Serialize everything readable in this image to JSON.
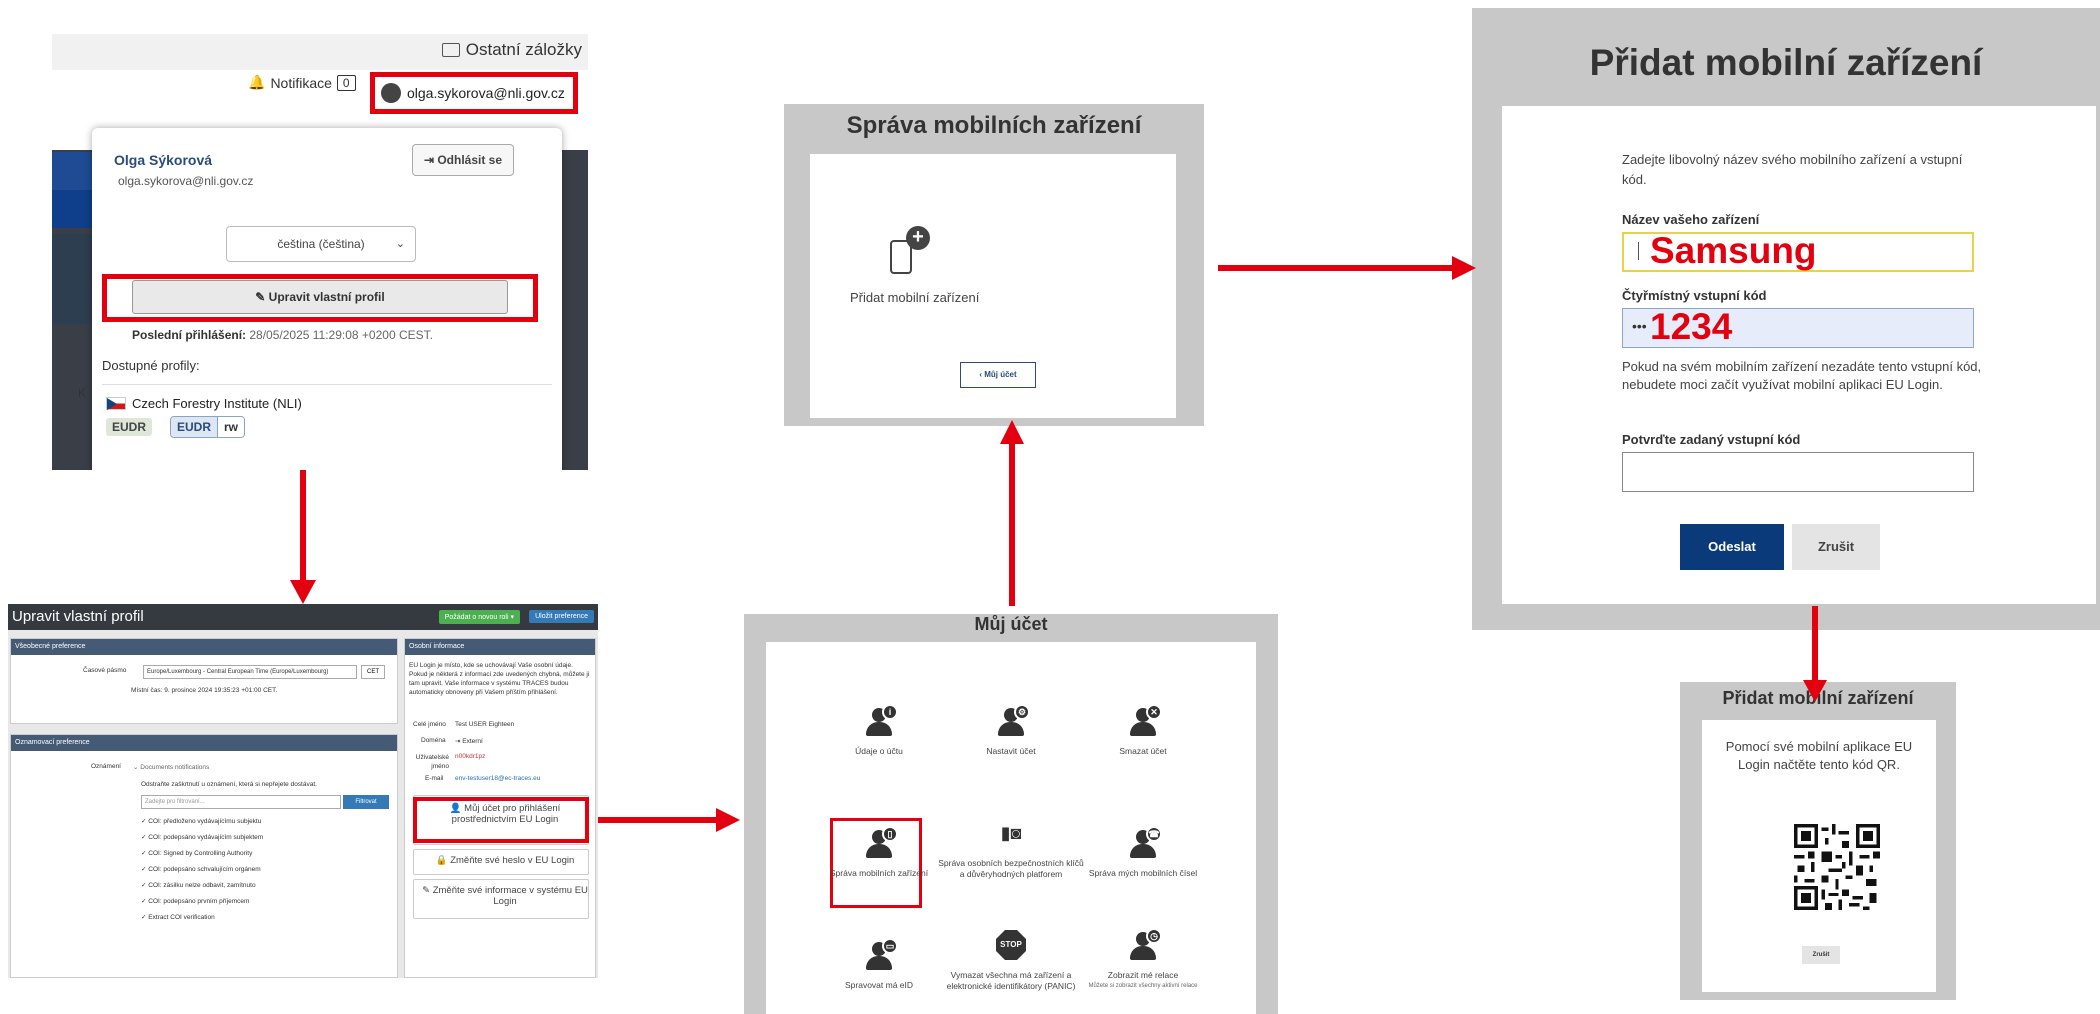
{
  "colors": {
    "highlight": "#e3000f",
    "primary": "#0b3a7a",
    "panel_bg": "#c8c8c8"
  },
  "panel1": {
    "bookmarks": "Ostatní záložky",
    "notifications_label": "Notifikace",
    "notifications_count": "0",
    "user_email": "olga.sykorova@nli.gov.cz",
    "name": "Olga Sýkorová",
    "email": "olga.sykorova@nli.gov.cz",
    "logout": "Odhlásit se",
    "language": "čeština (čeština)",
    "edit_profile": "Upravit vlastní profil",
    "last_login_label": "Poslední přihlášení:",
    "last_login_value": "28/05/2025 11:29:08 +0200 CEST.",
    "available_profiles": "Dostupné profily:",
    "org": "Czech Forestry Institute (NLI)",
    "tag1": "EUDR",
    "tag2a": "EUDR",
    "tag2b": "rw",
    "left_letter": "K"
  },
  "panel2": {
    "title": "Upravit vlastní profil",
    "btn_green": "Požádat o novou roli ▾",
    "btn_blue": "Uložit preference",
    "general_prefs": "Všeobecné preference",
    "timezone_label": "Časové pásmo",
    "timezone_value": "Europe/Luxembourg - Central European Time (Europe/Luxembourg)",
    "timezone_btn": "CET",
    "local_time": "Místní čas: 9. prosince 2024 19:35:23 +01:00 CET.",
    "notif_prefs": "Oznamovací preference",
    "notif_label": "Oznámení",
    "doc_notif": "Documents notifications",
    "notif_hint": "Odstraňte zaškrtnutí u oznámení, která si nepřejete dostávat.",
    "filter_placeholder": "Zadejte pro filtrování...",
    "filter_btn": "Filtrovat",
    "checks": [
      "COI: předloženo vydávajícímu subjektu",
      "COI: podepsáno vydávajícím subjektem",
      "COI: Signed by Controlling Authority",
      "COI: podepsáno schvalujícím orgánem",
      "COI: zásilku nelze odbavit, zamítnuto",
      "COI: podepsáno prvním příjemcem",
      "Extract COI verification"
    ],
    "personal_info": "Osobní informace",
    "personal_text": "EU Login je místo, kde se uchovávají Vaše osobní údaje. Pokud je některá z informací zde uvedených chybná, můžete ji tam upravit. Vaše informace v systému TRACES budou automaticky obnoveny při Vašem příštím přihlášení.",
    "fullname_label": "Celé jméno",
    "fullname_value": "Test USER Eighteen",
    "domain_label": "Doména",
    "domain_value": "Externí",
    "username_label": "Uživatelské jméno",
    "username_value": "n00kdr1pz",
    "email_label": "E-mail",
    "email_value": "env-testuser18@ec-traces.eu",
    "link1": "Můj účet pro přihlášení prostřednictvím EU Login",
    "link2": "Změňte své heslo v EU Login",
    "link3": "Změňte své informace v systému EU Login"
  },
  "panel3": {
    "title": "Správa mobilních zařízení",
    "add_device": "Přidat mobilní zařízení",
    "back": "‹ Můj účet"
  },
  "panel4": {
    "title": "Můj účet",
    "items": [
      {
        "label": "Údaje o účtu",
        "sub": ""
      },
      {
        "label": "Nastavit účet",
        "sub": ""
      },
      {
        "label": "Smazat účet",
        "sub": ""
      },
      {
        "label": "Správa mobilních zařízení",
        "sub": ""
      },
      {
        "label": "Správa osobních bezpečnostních klíčů a důvěryhodných platforem",
        "sub": ""
      },
      {
        "label": "Správa mých mobilních čísel",
        "sub": ""
      },
      {
        "label": "Spravovat má eID",
        "sub": ""
      },
      {
        "label": "Vymazat všechna má zařízení a elektronické identifikátory (PANIC)",
        "sub": ""
      },
      {
        "label": "Zobrazit mé relace",
        "sub": "Můžete si zobrazit všechny aktivní relace"
      }
    ],
    "stop": "STOP"
  },
  "panel5": {
    "title": "Přidat mobilní zařízení",
    "intro": "Zadejte libovolný název svého mobilního zařízení a vstupní kód.",
    "device_name_label": "Název vašeho zařízení",
    "device_name_value": "Samsung",
    "pin_label": "Čtyřmístný vstupní kód",
    "pin_dots": "•••",
    "pin_value": "1234",
    "warning": "Pokud na svém mobilním zařízení nezadáte tento vstupní kód, nebudete moci začít využívat mobilní aplikaci EU Login.",
    "confirm_label": "Potvrďte zadaný vstupní kód",
    "submit": "Odeslat",
    "cancel": "Zrušit"
  },
  "panel6": {
    "title": "Přidat mobilní zařízení",
    "text": "Pomocí své mobilní aplikace EU Login načtěte tento kód QR.",
    "cancel": "Zrušit"
  }
}
